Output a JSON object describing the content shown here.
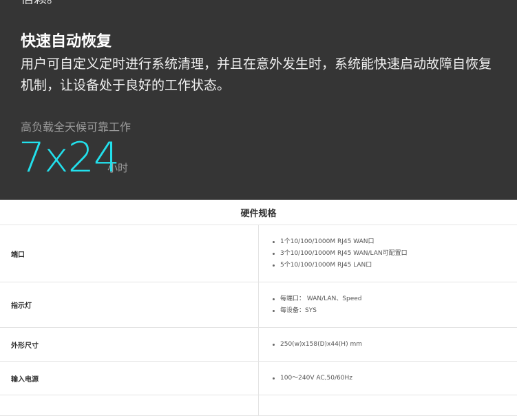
{
  "hero": {
    "cut_line": "信赖。",
    "feature_title": "快速自动恢复",
    "feature_body": "用户可自定义定时进行系统清理，并且在意外发生时，系统能快速启动故障自恢复机制，让设备处于良好的工作状态。",
    "uptime_caption": "高负载全天候可靠工作",
    "uptime_value": "7x24",
    "uptime_unit": "小时",
    "accent_color": "#22e0ec",
    "background_color": "#353535"
  },
  "specs": {
    "title": "硬件规格",
    "rows": [
      {
        "label": "端口",
        "items": [
          "1个10/100/1000M RJ45 WAN口",
          "3个10/100/1000M RJ45 WAN/LAN可配置口",
          "5个10/100/1000M RJ45 LAN口"
        ]
      },
      {
        "label": "指示灯",
        "items": [
          "每端口： WAN/LAN、Speed",
          "每设备：SYS"
        ]
      },
      {
        "label": "外形尺寸",
        "items": [
          "250(w)x158(D)x44(H) mm"
        ]
      },
      {
        "label": "输入电源",
        "items": [
          "100～240V AC,50/60Hz"
        ]
      }
    ]
  }
}
